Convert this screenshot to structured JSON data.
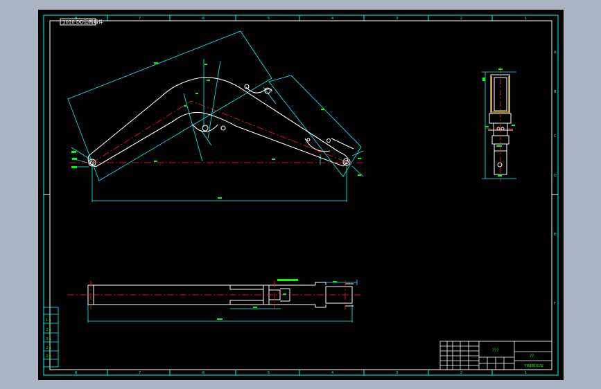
{
  "drawing": {
    "title_tag": "1010 DD动臂组件",
    "title_block": {
      "name_field": "???",
      "scale_field": "??",
      "code_field": "YWJBDGSJ"
    },
    "border_numbers": {
      "top": [
        "8",
        "7",
        "6",
        "5",
        "4",
        "3",
        "2",
        "1"
      ],
      "right": [
        "A",
        "B",
        "C",
        "D",
        "E",
        "F"
      ]
    },
    "revision_rows": [
      "1:1",
      "2:1",
      "3:1",
      "2:1",
      "2:1"
    ],
    "colors": {
      "background": "#000000",
      "frame": "#00ffff",
      "outline": "#ffffff",
      "centerline": "#ff2020",
      "text": "#00ff00",
      "frame_surround": "#a9b5c2"
    }
  },
  "ui": {
    "canvas_name": "cad-drawing-sheet"
  }
}
